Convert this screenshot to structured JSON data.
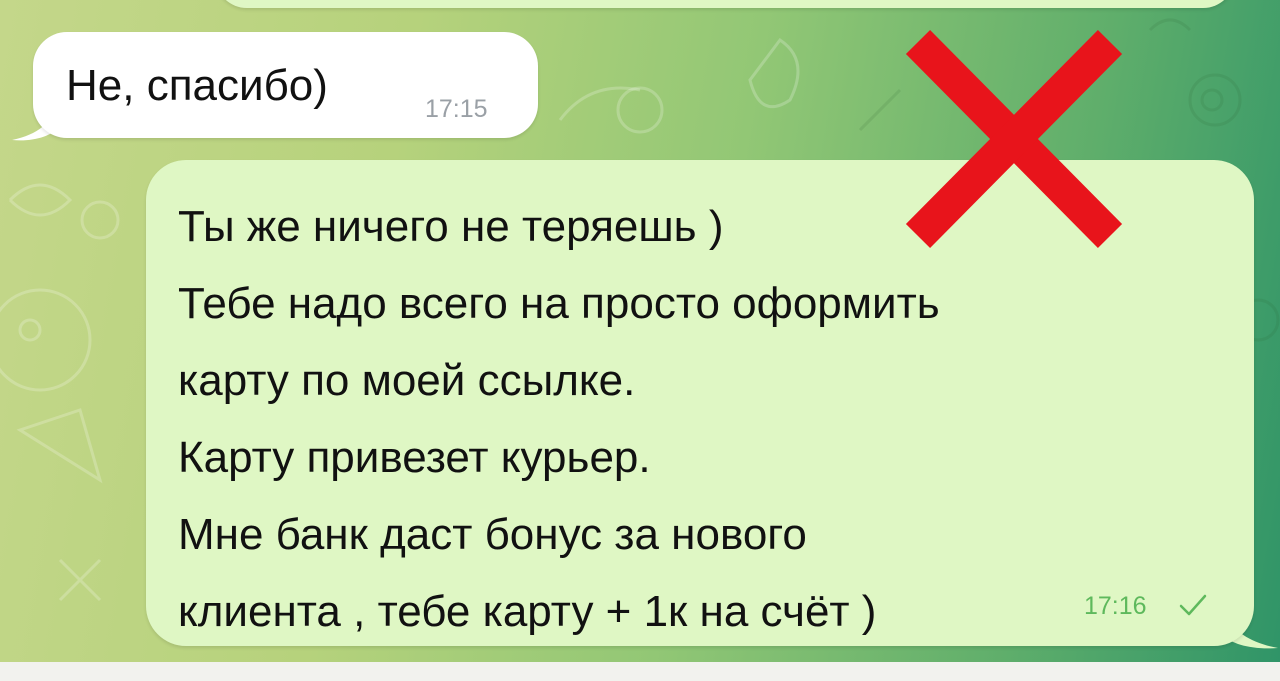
{
  "colors": {
    "incoming_bubble": "#ffffff",
    "outgoing_bubble": "#dff7c4",
    "incoming_time": "#9aa0a6",
    "outgoing_time": "#5eb95c",
    "cross": "#e8141b",
    "background_left": "#c4d78a",
    "background_right": "#2f9468"
  },
  "incoming_message": {
    "text": "Не, спасибо)",
    "time": "17:15"
  },
  "outgoing_message": {
    "lines": [
      "Ты же ничего не теряешь )",
      "Тебе надо всего на просто оформить",
      "карту по моей ссылке.",
      "Карту привезет курьер.",
      "Мне банк даст бонус за нового",
      "клиента , тебе карту + 1к на счёт )"
    ],
    "time": "17:16",
    "status_icon": "single-check-icon"
  },
  "overlay": {
    "icon": "red-cross-icon"
  }
}
